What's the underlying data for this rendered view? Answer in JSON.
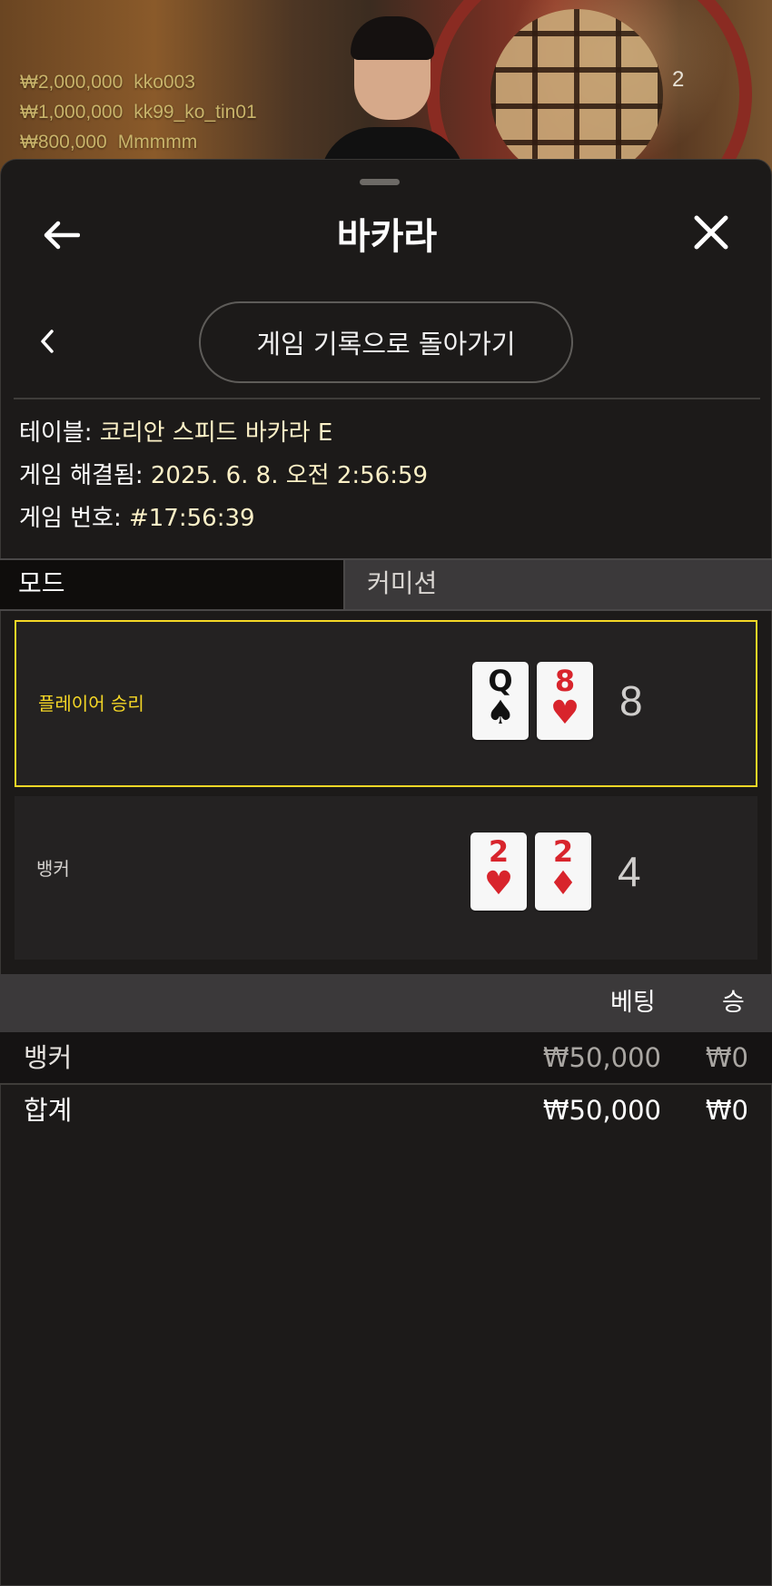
{
  "video": {
    "recent_bets": [
      {
        "amount": "₩2,000,000",
        "user": "kko003"
      },
      {
        "amount": "₩1,000,000",
        "user": "kk99_ko_tin01"
      },
      {
        "amount": "₩800,000",
        "user": "Mmmmm"
      }
    ],
    "viewer_count": "2"
  },
  "header": {
    "title": "바카라",
    "back_icon": "arrow-left-icon",
    "close_icon": "close-icon"
  },
  "nav": {
    "prev_icon": "chevron-left-icon",
    "back_to_history_label": "게임 기록으로 돌아가기"
  },
  "details": {
    "table_label": "테이블:",
    "table_value": "코리안 스피드 바카라 E",
    "resolved_label": "게임 해결됨:",
    "resolved_value": "2025. 6. 8. 오전 2:56:59",
    "number_label": "게임 번호:",
    "number_value": "#17:56:39"
  },
  "mode_bar": {
    "mode_label": "모드",
    "commission_label": "커미션"
  },
  "results": {
    "player": {
      "label": "플레이어 승리",
      "cards": [
        {
          "rank": "Q",
          "suit": "♠",
          "color": "black"
        },
        {
          "rank": "8",
          "suit": "♥",
          "color": "red"
        }
      ],
      "score": "8"
    },
    "banker": {
      "label": "뱅커",
      "cards": [
        {
          "rank": "2",
          "suit": "♥",
          "color": "red"
        },
        {
          "rank": "2",
          "suit": "♦",
          "color": "red"
        }
      ],
      "score": "4"
    }
  },
  "bets_table": {
    "headers": {
      "bet": "베팅",
      "win": "승"
    },
    "rows": [
      {
        "name": "뱅커",
        "bet": "₩50,000",
        "win": "₩0"
      }
    ],
    "total": {
      "name": "합계",
      "bet": "₩50,000",
      "win": "₩0"
    }
  },
  "colors": {
    "accent_yellow": "#f5d726",
    "background": "#1c1a19",
    "card_red": "#d8242c"
  }
}
